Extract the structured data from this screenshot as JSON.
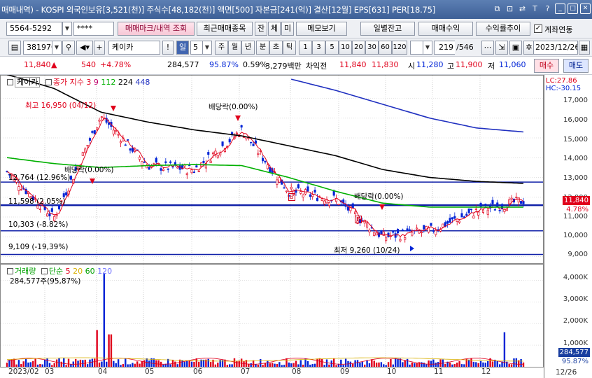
{
  "titlebar": {
    "text": "매매내역) - KOSPI 외국인보유[3,521(천)] 주식수[48,182(천)] 액면[500] 자본금[241(억)] 결산[12월] EPS[631] PER[18.75]",
    "btn_copy": "⧉",
    "btn_frame": "⊡",
    "btn_swap": "⇄",
    "btn_t": "T",
    "btn_help": "?",
    "btn_min": "_",
    "btn_max": "□",
    "btn_close": "✕"
  },
  "row1": {
    "account": "5564-5292",
    "password": "****",
    "mark_button": "매매마크/내역 조회",
    "recent_button": "최근매매종목",
    "jan": "잔",
    "che": "체",
    "mi": "미",
    "memo": "메모보기",
    "daily_balance": "일별잔고",
    "trade_profit": "매매수익",
    "return_trend": "수익률추이",
    "account_link_label": "계좌연동",
    "account_link_checked": "✓"
  },
  "row2": {
    "code": "381970",
    "stock_name": "케이카",
    "sin_badge": "신",
    "excl": "!",
    "period_day": "일",
    "period_num": "5",
    "periods": [
      "주",
      "월",
      "년",
      "분",
      "초",
      "틱"
    ],
    "numbers": [
      "1",
      "3",
      "5",
      "10",
      "20",
      "30",
      "60",
      "120"
    ],
    "count": "219",
    "total": "/546",
    "date": "2023/12/26"
  },
  "quote": {
    "price": "11,840",
    "arrow": "▲",
    "change": "540",
    "change_pct": "+4.78%",
    "volume": "284,577",
    "vol_ratio": "95.87%",
    "turnover": "0.59%",
    "amount": "3,279백만",
    "order_label": "차익전",
    "ask": "11,840",
    "bid": "11,830",
    "open_label": "시",
    "open": "11,280",
    "high_label": "고",
    "high": "11,900",
    "low_label": "저",
    "low": "11,060",
    "buy_button": "매수",
    "sell_button": "매도"
  },
  "price_panel": {
    "stock_tag": "케이카",
    "ma_label": "종가 지수",
    "ma_periods": [
      "3",
      "9",
      "112",
      "224",
      "448"
    ],
    "ma_colors": [
      "#e0001b",
      "#c0006a",
      "#00b000",
      "#000000",
      "#2030c0"
    ],
    "lc_label": "LC:27.86",
    "hc_label": "HC:-30.15",
    "high_note": "최고 16,950 (04/12)",
    "low_note": "최저 9,260 (10/24)",
    "dividend_1": "배당락(0.00%)",
    "dividend_2": "배당락(0.00%)",
    "dividend_3": "배당락(0.00%)",
    "level_1": "12,764 (12.96%)",
    "level_2": "11,598 (2.05%)",
    "level_3": "10,303 (-8.82%)",
    "level_4": "9,109 (-19,39%)",
    "y_ticks": [
      "17,000",
      "16,000",
      "15,000",
      "14,000",
      "13,000",
      "12,000",
      "11,000",
      "10,000",
      "9,000"
    ],
    "last_price_tag": "11,840",
    "last_pct_tag": "4.78%",
    "markers": [
      "B",
      "B"
    ]
  },
  "volume_panel": {
    "title": "거래량",
    "ma_label": "단순",
    "ma_periods": [
      "5",
      "20",
      "60",
      "120"
    ],
    "ma_colors": [
      "#e0001b",
      "#d8b000",
      "#00a000",
      "#7070ff"
    ],
    "value": "284,577주(95,87%)",
    "y_ticks": [
      "4,000K",
      "3,000K",
      "2,000K",
      "1,000K"
    ],
    "last_tag": "284,577",
    "last_pct": "95.87%"
  },
  "x_axis": {
    "ticks": [
      "2023/02",
      "03",
      "04",
      "05",
      "06",
      "07",
      "08",
      "09",
      "10",
      "11",
      "12"
    ],
    "end": "12/26"
  },
  "colors": {
    "up": "#e0001b",
    "down": "#0024d6",
    "ma3": "#e0001b",
    "ma112": "#00b000",
    "ma224": "#000000",
    "ma448": "#2030c0"
  },
  "chart_data": [
    {
      "type": "line",
      "x": [
        "2023/02",
        "03",
        "04",
        "05",
        "06",
        "07",
        "08",
        "09",
        "10",
        "11",
        "12",
        "12/26"
      ],
      "series": [
        {
          "name": "종가",
          "values": [
            13300,
            10950,
            16100,
            13600,
            13400,
            15400,
            12300,
            11900,
            10000,
            10300,
            11300,
            11840
          ]
        },
        {
          "name": "112",
          "values": [
            14000,
            13700,
            13500,
            13600,
            13650,
            13600,
            13000,
            12300,
            11700,
            11500,
            11500,
            11500
          ]
        },
        {
          "name": "224",
          "values": [
            18200,
            17500,
            16300,
            15800,
            15400,
            15100,
            14600,
            14100,
            13400,
            13000,
            12800,
            12700
          ]
        },
        {
          "name": "448",
          "values": [
            null,
            null,
            null,
            null,
            null,
            null,
            18000,
            17400,
            16700,
            16000,
            15500,
            15300
          ]
        }
      ],
      "ylim": [
        9000,
        17500
      ]
    },
    {
      "type": "bar",
      "title": "거래량",
      "highlight": [
        {
          "x": "04",
          "value": 4300
        },
        {
          "x": "12",
          "value": 1600
        }
      ],
      "ylim": [
        0,
        4500
      ]
    }
  ]
}
